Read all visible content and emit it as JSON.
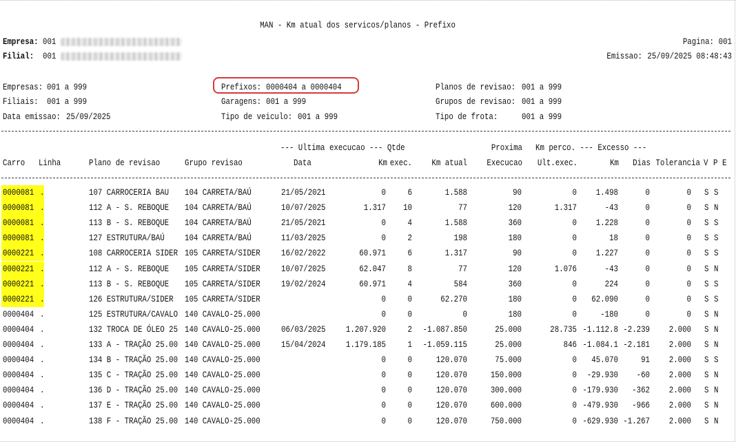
{
  "report": {
    "title": "MAN - Km atual dos servicos/planos - Prefixo",
    "empresa_label": "Empresa:",
    "empresa_code": "001",
    "filial_label": "Filial:",
    "filial_code": "001",
    "pagina_label": "Pagina:",
    "pagina_value": "001",
    "emissao_label": "Emissao:",
    "emissao_value": "25/09/2025 08:48:43"
  },
  "filters": {
    "empresas": {
      "label": "Empresas:",
      "value": "001 a 999"
    },
    "filiais": {
      "label": "Filiais:",
      "value": "001 a 999"
    },
    "data_emissao": {
      "label": "Data emissao:",
      "value": "25/09/2025"
    },
    "prefixos": {
      "label": "Prefixos:",
      "value": "0000404 a 0000404"
    },
    "garagens": {
      "label": "Garagens:",
      "value": "001 a 999"
    },
    "tipo_veiculo": {
      "label": "Tipo de veiculo:",
      "value": "001 a 999"
    },
    "planos_revisao": {
      "label": "Planos de revisao:",
      "value": "001 a 999"
    },
    "grupos_revisao": {
      "label": "Grupos de revisao:",
      "value": "001 a 999"
    },
    "tipo_frota": {
      "label": "Tipo de frota:",
      "value": "001 a 999"
    }
  },
  "header": {
    "group1": "--- Ultima execucao --- Qtde",
    "proxima": "Proxima",
    "group2": "Km perco. --- Excesso ---",
    "carro": "Carro",
    "linha": "Linha",
    "plano": "Plano de revisao",
    "grupo": "Grupo revisao",
    "data": "Data",
    "km": "Km",
    "exec": "exec.",
    "km_atual": "Km atual",
    "execucao": "Execucao",
    "ult_exec": "Ult.exec.",
    "exc_km": "Km",
    "dias": "Dias",
    "tolerancia": "Tolerancia",
    "v": "V",
    "p": "P",
    "e": "E"
  },
  "colors": {
    "highlight": "#ffff1a",
    "callout": "#d43a3a"
  },
  "rows": [
    {
      "carro": "0000081",
      "linha": ".",
      "plano": "107 CARROCERIA BAU",
      "grupo": "104 CARRETA/BAÚ",
      "data": "21/05/2021",
      "km": "0",
      "qtde": "6",
      "km_atual": "1.588",
      "proxima": "90",
      "km_perco": "0",
      "exc_km": "1.498",
      "dias": "0",
      "tolerancia": "0",
      "v": "S",
      "p": "S",
      "e": ""
    },
    {
      "carro": "0000081",
      "linha": ".",
      "plano": "112 A - S. REBOQUE",
      "grupo": "104 CARRETA/BAÚ",
      "data": "10/07/2025",
      "km": "1.317",
      "qtde": "10",
      "km_atual": "77",
      "proxima": "120",
      "km_perco": "1.317",
      "exc_km": "-43",
      "dias": "0",
      "tolerancia": "0",
      "v": "S",
      "p": "N",
      "e": ""
    },
    {
      "carro": "0000081",
      "linha": ".",
      "plano": "113 B - S. REBOQUE",
      "grupo": "104 CARRETA/BAÚ",
      "data": "21/05/2021",
      "km": "0",
      "qtde": "4",
      "km_atual": "1.588",
      "proxima": "360",
      "km_perco": "0",
      "exc_km": "1.228",
      "dias": "0",
      "tolerancia": "0",
      "v": "S",
      "p": "S",
      "e": ""
    },
    {
      "carro": "0000081",
      "linha": ".",
      "plano": "127 ESTRUTURA/BAÚ",
      "grupo": "104 CARRETA/BAÚ",
      "data": "11/03/2025",
      "km": "0",
      "qtde": "2",
      "km_atual": "198",
      "proxima": "180",
      "km_perco": "0",
      "exc_km": "18",
      "dias": "0",
      "tolerancia": "0",
      "v": "S",
      "p": "S",
      "e": ""
    },
    {
      "carro": "0000221",
      "linha": ".",
      "plano": "108 CARROCERIA SIDER",
      "grupo": "105 CARRETA/SIDER",
      "data": "16/02/2022",
      "km": "60.971",
      "qtde": "6",
      "km_atual": "1.317",
      "proxima": "90",
      "km_perco": "0",
      "exc_km": "1.227",
      "dias": "0",
      "tolerancia": "0",
      "v": "S",
      "p": "S",
      "e": ""
    },
    {
      "carro": "0000221",
      "linha": ".",
      "plano": "112 A - S. REBOQUE",
      "grupo": "105 CARRETA/SIDER",
      "data": "10/07/2025",
      "km": "62.047",
      "qtde": "8",
      "km_atual": "77",
      "proxima": "120",
      "km_perco": "1.076",
      "exc_km": "-43",
      "dias": "0",
      "tolerancia": "0",
      "v": "S",
      "p": "N",
      "e": ""
    },
    {
      "carro": "0000221",
      "linha": ".",
      "plano": "113 B - S. REBOQUE",
      "grupo": "105 CARRETA/SIDER",
      "data": "19/02/2024",
      "km": "60.971",
      "qtde": "4",
      "km_atual": "584",
      "proxima": "360",
      "km_perco": "0",
      "exc_km": "224",
      "dias": "0",
      "tolerancia": "0",
      "v": "S",
      "p": "S",
      "e": ""
    },
    {
      "carro": "0000221",
      "linha": ".",
      "plano": "126 ESTRUTURA/SIDER",
      "grupo": "105 CARRETA/SIDER",
      "data": "",
      "km": "0",
      "qtde": "0",
      "km_atual": "62.270",
      "proxima": "180",
      "km_perco": "0",
      "exc_km": "62.090",
      "dias": "0",
      "tolerancia": "0",
      "v": "S",
      "p": "S",
      "e": ""
    },
    {
      "carro": "0000404",
      "linha": ".",
      "plano": "125 ESTRUTURA/CAVALO",
      "grupo": "140 CAVALO-25.000",
      "data": "",
      "km": "0",
      "qtde": "0",
      "km_atual": "0",
      "proxima": "180",
      "km_perco": "0",
      "exc_km": "-180",
      "dias": "0",
      "tolerancia": "0",
      "v": "S",
      "p": "N",
      "e": ""
    },
    {
      "carro": "0000404",
      "linha": ".",
      "plano": "132 TROCA DE ÓLEO 25",
      "grupo": "140 CAVALO-25.000",
      "data": "06/03/2025",
      "km": "1.207.920",
      "qtde": "2",
      "km_atual": "-1.087.850",
      "proxima": "25.000",
      "km_perco": "28.735",
      "exc_km": "-1.112.8",
      "dias": "-2.239",
      "tolerancia": "2.000",
      "v": "S",
      "p": "N",
      "e": ""
    },
    {
      "carro": "0000404",
      "linha": ".",
      "plano": "133 A - TRAÇÃO 25.00",
      "grupo": "140 CAVALO-25.000",
      "data": "15/04/2024",
      "km": "1.179.185",
      "qtde": "1",
      "km_atual": "-1.059.115",
      "proxima": "25.000",
      "km_perco": "846",
      "exc_km": "-1.084.1",
      "dias": "-2.181",
      "tolerancia": "2.000",
      "v": "S",
      "p": "N",
      "e": ""
    },
    {
      "carro": "0000404",
      "linha": ".",
      "plano": "134 B - TRAÇÃO 25.00",
      "grupo": "140 CAVALO-25.000",
      "data": "",
      "km": "0",
      "qtde": "0",
      "km_atual": "120.070",
      "proxima": "75.000",
      "km_perco": "0",
      "exc_km": "45.070",
      "dias": "91",
      "tolerancia": "2.000",
      "v": "S",
      "p": "S",
      "e": ""
    },
    {
      "carro": "0000404",
      "linha": ".",
      "plano": "135 C - TRAÇÃO 25.00",
      "grupo": "140 CAVALO-25.000",
      "data": "",
      "km": "0",
      "qtde": "0",
      "km_atual": "120.070",
      "proxima": "150.000",
      "km_perco": "0",
      "exc_km": "-29.930",
      "dias": "-60",
      "tolerancia": "2.000",
      "v": "S",
      "p": "N",
      "e": ""
    },
    {
      "carro": "0000404",
      "linha": ".",
      "plano": "136 D - TRAÇÃO 25.00",
      "grupo": "140 CAVALO-25.000",
      "data": "",
      "km": "0",
      "qtde": "0",
      "km_atual": "120.070",
      "proxima": "300.000",
      "km_perco": "0",
      "exc_km": "-179.930",
      "dias": "-362",
      "tolerancia": "2.000",
      "v": "S",
      "p": "N",
      "e": ""
    },
    {
      "carro": "0000404",
      "linha": ".",
      "plano": "137 E - TRAÇÃO 25.00",
      "grupo": "140 CAVALO-25.000",
      "data": "",
      "km": "0",
      "qtde": "0",
      "km_atual": "120.070",
      "proxima": "600.000",
      "km_perco": "0",
      "exc_km": "-479.930",
      "dias": "-966",
      "tolerancia": "2.000",
      "v": "S",
      "p": "N",
      "e": ""
    },
    {
      "carro": "0000404",
      "linha": ".",
      "plano": "138 F - TRAÇÃO 25.00",
      "grupo": "140 CAVALO-25.000",
      "data": "",
      "km": "0",
      "qtde": "0",
      "km_atual": "120.070",
      "proxima": "750.000",
      "km_perco": "0",
      "exc_km": "-629.930",
      "dias": "-1.267",
      "tolerancia": "2.000",
      "v": "S",
      "p": "N",
      "e": ""
    }
  ]
}
